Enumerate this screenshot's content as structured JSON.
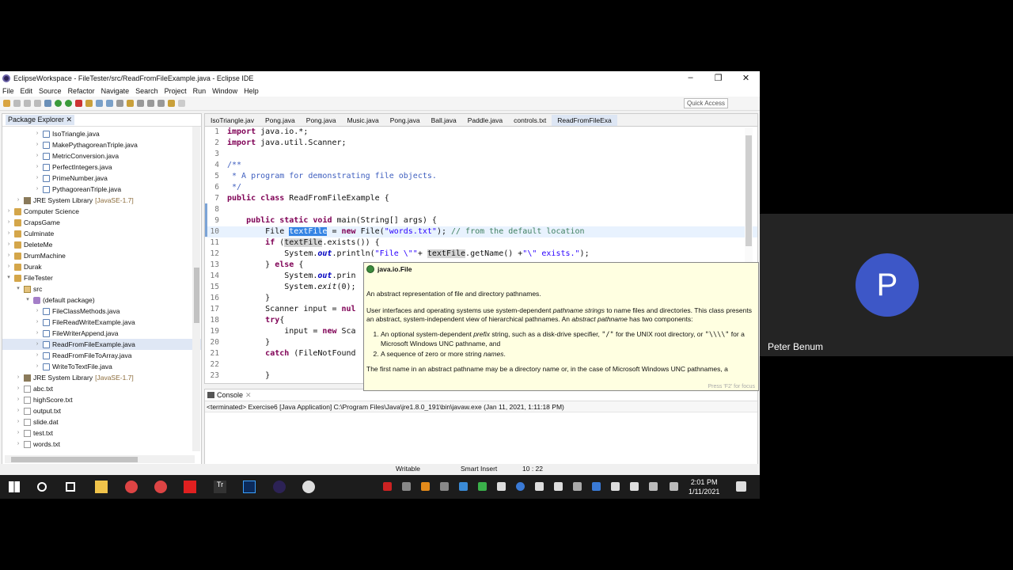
{
  "window": {
    "title": "EclipseWorkspace - FileTester/src/ReadFromFileExample.java - Eclipse IDE"
  },
  "menu": [
    "File",
    "Edit",
    "Source",
    "Refactor",
    "Navigate",
    "Search",
    "Project",
    "Run",
    "Window",
    "Help"
  ],
  "toolbar": {
    "quick_access": "Quick Access"
  },
  "package_explorer": {
    "title": "Package Explorer",
    "rows": [
      {
        "label": "IsoTriangle.java",
        "indent": 3,
        "icon": "java"
      },
      {
        "label": "MakePythagoreanTriple.java",
        "indent": 3,
        "icon": "java"
      },
      {
        "label": "MetricConversion.java",
        "indent": 3,
        "icon": "java"
      },
      {
        "label": "PerfectIntegers.java",
        "indent": 3,
        "icon": "java"
      },
      {
        "label": "PrimeNumber.java",
        "indent": 3,
        "icon": "java"
      },
      {
        "label": "PythagoreanTriple.java",
        "indent": 3,
        "icon": "java"
      },
      {
        "label": "JRE System Library",
        "suffix": "[JavaSE-1.7]",
        "indent": 1,
        "icon": "lib",
        "twisty": ">"
      },
      {
        "label": "Computer Science",
        "indent": 0,
        "icon": "proj",
        "twisty": ">"
      },
      {
        "label": "CrapsGame",
        "indent": 0,
        "icon": "proj",
        "twisty": ">"
      },
      {
        "label": "Culminate",
        "indent": 0,
        "icon": "proj",
        "twisty": ">"
      },
      {
        "label": "DeleteMe",
        "indent": 0,
        "icon": "proj",
        "twisty": ">"
      },
      {
        "label": "DrumMachine",
        "indent": 0,
        "icon": "proj",
        "twisty": ">"
      },
      {
        "label": "Durak",
        "indent": 0,
        "icon": "proj",
        "twisty": ">"
      },
      {
        "label": "FileTester",
        "indent": 0,
        "icon": "proj",
        "twisty": "v"
      },
      {
        "label": "src",
        "indent": 1,
        "icon": "src",
        "twisty": "v"
      },
      {
        "label": "(default package)",
        "indent": 2,
        "icon": "pkgi",
        "twisty": "v"
      },
      {
        "label": "FileClassMethods.java",
        "indent": 3,
        "icon": "java"
      },
      {
        "label": "FileReadWriteExample.java",
        "indent": 3,
        "icon": "java"
      },
      {
        "label": "FileWriterAppend.java",
        "indent": 3,
        "icon": "java"
      },
      {
        "label": "ReadFromFileExample.java",
        "indent": 3,
        "icon": "java",
        "selected": true
      },
      {
        "label": "ReadFromFileToArray.java",
        "indent": 3,
        "icon": "java"
      },
      {
        "label": "WriteToTextFile.java",
        "indent": 3,
        "icon": "java"
      },
      {
        "label": "JRE System Library",
        "suffix": "[JavaSE-1.7]",
        "indent": 1,
        "icon": "lib",
        "twisty": ">"
      },
      {
        "label": "abc.txt",
        "indent": 1,
        "icon": "file"
      },
      {
        "label": "highScore.txt",
        "indent": 1,
        "icon": "file"
      },
      {
        "label": "output.txt",
        "indent": 1,
        "icon": "file"
      },
      {
        "label": "slide.dat",
        "indent": 1,
        "icon": "file"
      },
      {
        "label": "test.txt",
        "indent": 1,
        "icon": "file"
      },
      {
        "label": "words.txt",
        "indent": 1,
        "icon": "file"
      }
    ]
  },
  "editor": {
    "tabs": [
      "IsoTriangle.jav",
      "Pong.java",
      "Pong.java",
      "Music.java",
      "Pong.java",
      "Ball.java",
      "Paddle.java",
      "controls.txt",
      "ReadFromFileExa"
    ],
    "active_tab": 8,
    "lines": [
      {
        "n": "1",
        "html": "<span class='kw'>import</span> java.io.*;"
      },
      {
        "n": "2",
        "html": "<span class='kw'>import</span> java.util.Scanner;"
      },
      {
        "n": "3",
        "html": ""
      },
      {
        "n": "4",
        "html": "<span class='doc'>/**</span>"
      },
      {
        "n": "5",
        "html": "<span class='doc'> * A program for demonstrating file objects.</span>"
      },
      {
        "n": "6",
        "html": "<span class='doc'> */</span>"
      },
      {
        "n": "7",
        "html": "<span class='kw'>public</span> <span class='kw'>class</span> ReadFromFileExample {"
      },
      {
        "n": "8",
        "html": ""
      },
      {
        "n": "9",
        "html": "    <span class='kw'>public</span> <span class='kw'>static</span> <span class='kw'>void</span> main(String[] args) {"
      },
      {
        "n": "10",
        "html": "        File <span class='hl'>textFile</span> = <span class='kw'>new</span> File(<span class='str'>\"words.txt\"</span>); <span class='cmt'>// from the default location</span>",
        "current": true
      },
      {
        "n": "11",
        "html": "        <span class='kw'>if</span> (<span class='occ'>textFile</span>.exists()) {"
      },
      {
        "n": "12",
        "html": "            System.<span class='fld'>out</span>.println(<span class='str'>\"File \\\"\"</span>+ <span class='occ'>textFile</span>.getName() +<span class='str'>\"\\\" exists.\"</span>);"
      },
      {
        "n": "13",
        "html": "        } <span class='kw'>else</span> {"
      },
      {
        "n": "14",
        "html": "            System.<span class='fld'>out</span>.prin"
      },
      {
        "n": "15",
        "html": "            System.<span class='ital'>exit</span>(0);"
      },
      {
        "n": "16",
        "html": "        }"
      },
      {
        "n": "17",
        "html": "        Scanner input = <span class='kw'>nul</span>"
      },
      {
        "n": "18",
        "html": "        <span class='kw'>try</span>{"
      },
      {
        "n": "19",
        "html": "            input = <span class='kw'>new</span> Sca"
      },
      {
        "n": "20",
        "html": "        }"
      },
      {
        "n": "21",
        "html": "        <span class='kw'>catch</span> (FileNotFound"
      },
      {
        "n": "22",
        "html": ""
      },
      {
        "n": "23",
        "html": "        }"
      }
    ]
  },
  "hover": {
    "title": "java.io.File",
    "p1": "An abstract representation of file and directory pathnames.",
    "p2_html": "User interfaces and operating systems use system-dependent <i>pathname strings</i> to name files and directories. This class presents an abstract, system-independent view of hierarchical pathnames. An <i>abstract pathname</i> has two components:",
    "li1_html": "An optional system-dependent <i>prefix</i> string, such as a disk-drive specifier, <span style='font-family:monospace'>\"/\"</span> for the UNIX root directory, or <span style='font-family:monospace'>\"\\\\\\\\\"</span> for a Microsoft Windows UNC pathname, and",
    "li2_html": "A sequence of zero or more string <i>names</i>.",
    "p3": "The first name in an abstract pathname may be a directory name or, in the case of Microsoft Windows UNC pathnames, a",
    "footer": "Press 'F2' for focus"
  },
  "console": {
    "title": "Console",
    "status": "<terminated> Exercise6 [Java Application] C:\\Program Files\\Java\\jre1.8.0_191\\bin\\javaw.exe (Jan 11, 2021, 1:11:18 PM)"
  },
  "statusbar": {
    "mode": "Writable",
    "insert": "Smart Insert",
    "position": "10 : 22"
  },
  "taskbar": {
    "time": "2:01 PM",
    "date": "1/11/2021"
  },
  "participant": {
    "initial": "P",
    "name": "Peter Benum",
    "avatar_color": "#3d57c7"
  }
}
